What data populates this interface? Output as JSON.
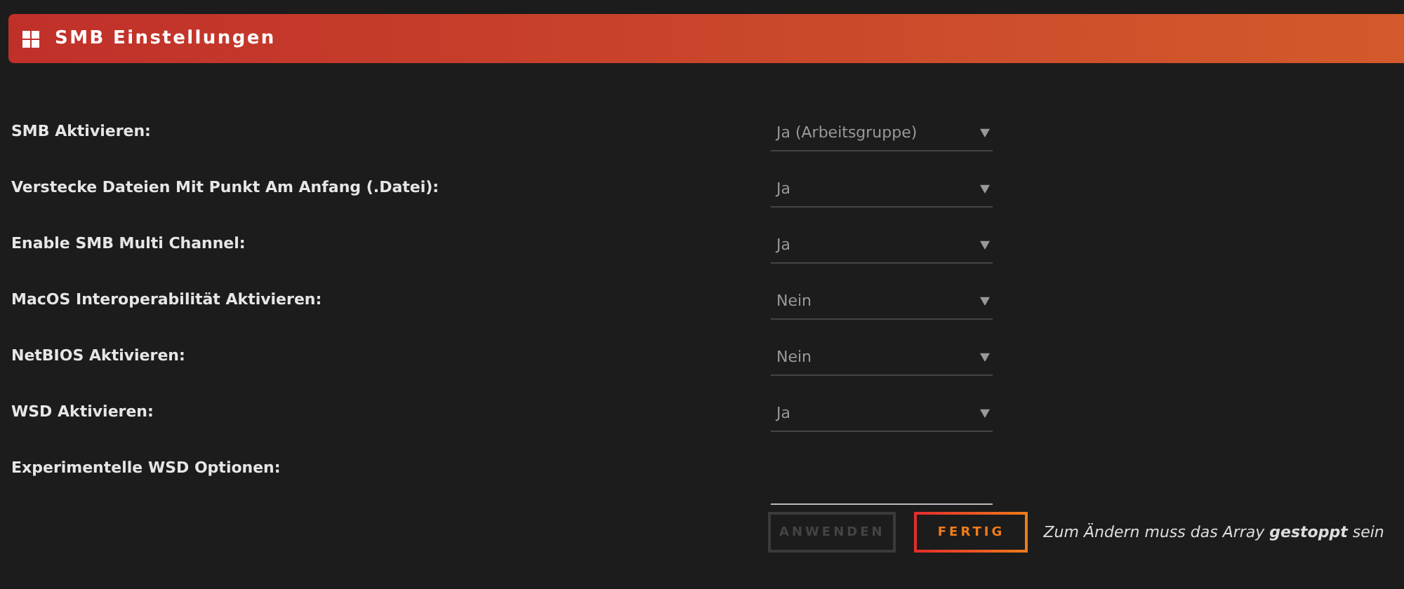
{
  "header": {
    "title": "SMB Einstellungen"
  },
  "settings": [
    {
      "label": "SMB Aktivieren:",
      "kind": "select",
      "value": "Ja (Arbeitsgruppe)"
    },
    {
      "label": "Verstecke Dateien Mit Punkt Am Anfang (.Datei):",
      "kind": "select",
      "value": "Ja"
    },
    {
      "label": "Enable SMB Multi Channel:",
      "kind": "select",
      "value": "Ja"
    },
    {
      "label": "MacOS Interoperabilität Aktivieren:",
      "kind": "select",
      "value": "Nein"
    },
    {
      "label": "NetBIOS Aktivieren:",
      "kind": "select",
      "value": "Nein"
    },
    {
      "label": "WSD Aktivieren:",
      "kind": "select",
      "value": "Ja"
    },
    {
      "label": "Experimentelle WSD Optionen:",
      "kind": "text"
    }
  ],
  "buttons": [
    {
      "label": "ANWENDEN",
      "disabled": true
    },
    {
      "label": "FERTIG",
      "disabled": false
    }
  ],
  "note": "Zum Ändern muss das Array **gestoppt** sein"
}
